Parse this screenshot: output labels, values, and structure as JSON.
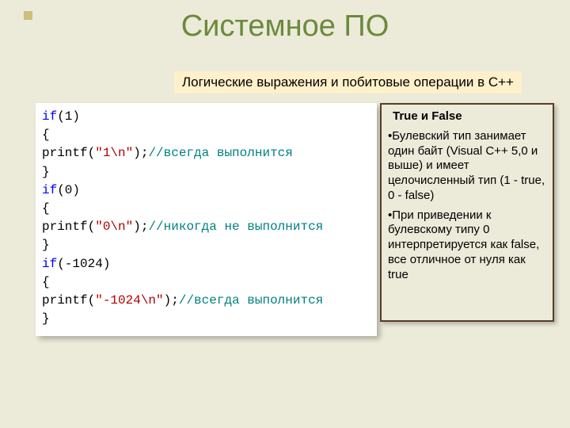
{
  "title": "Системное ПО",
  "subtitle": "Логические выражения и побитовые операции в С++",
  "code": {
    "kw_if": "if",
    "r1_cond": "(1)",
    "brace_o": "{",
    "brace_c": "}",
    "indent_printf": "    printf(",
    "r1_str": "\"1\\n\"",
    "printf_close": ");",
    "r1_cmt": "//всегда выполнится",
    "r2_cond": "(0)",
    "r2_str": "\"0\\n\"",
    "r2_cmt": "//никогда не выполнится",
    "r3_cond": "(-1024)",
    "r3_str": "\"-1024\\n\"",
    "r3_cmt": "//всегда выполнится"
  },
  "side": {
    "heading": "True и False",
    "b1": "Булевский тип занимает один байт (Visual C++ 5,0 и выше) и имеет целочисленный тип (1 - true, 0 - false)",
    "b2": "При приведении к булевскому типу 0 интерпретируется как false, все отличное от нуля как true"
  }
}
